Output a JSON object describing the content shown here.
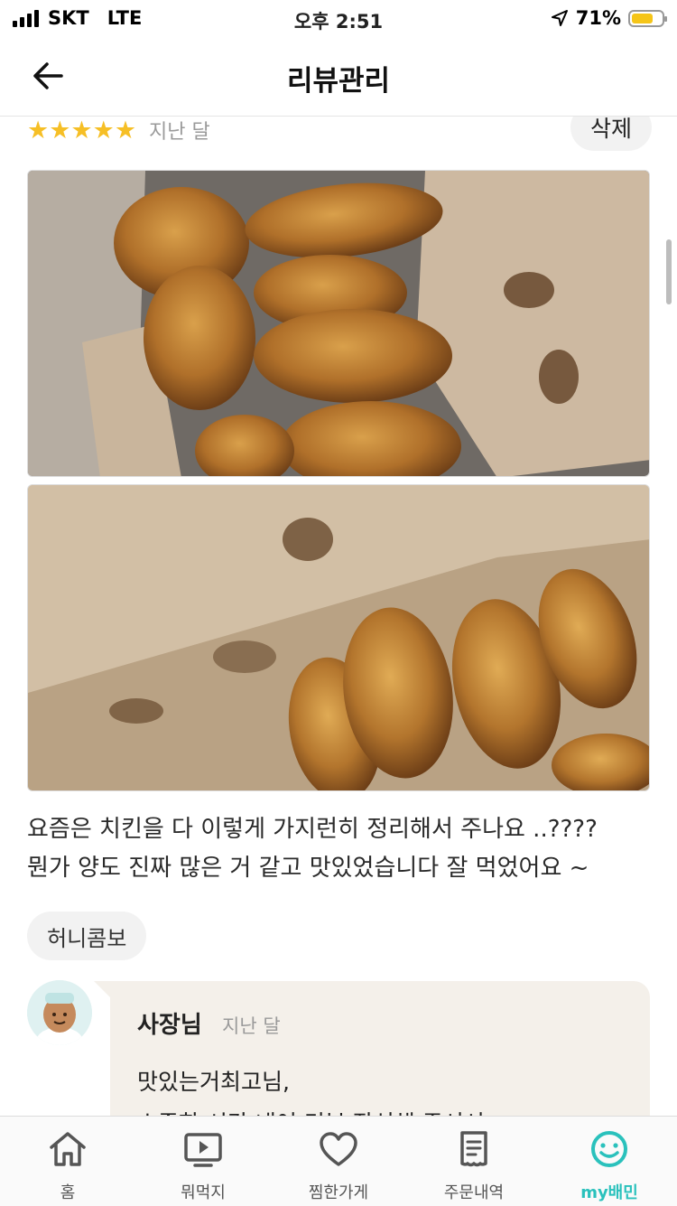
{
  "status_bar": {
    "carrier": "SKT",
    "network": "LTE",
    "time": "오후 2:51",
    "battery": "71%",
    "battery_level": 0.71
  },
  "nav": {
    "title": "리뷰관리",
    "back_icon": "arrow-left-icon"
  },
  "review": {
    "stars": "★★★★★",
    "rating": 5,
    "ago": "지난 달",
    "delete_label": "삭제",
    "text_lines": [
      "요즘은 치킨을 다 이렇게 가지런히 정리해서 주나요 ..????",
      "뭔가 양도 진짜 많은 거 같고 맛있었습니다 잘 먹었어요 ~"
    ],
    "menu_tag": "허니콤보"
  },
  "owner_reply": {
    "name": "사장님",
    "ago": "지난 달",
    "lines": [
      "맛있는거최고님,",
      "소중한 시간 내어 리뷰 작성해 주셔서"
    ]
  },
  "tabs": [
    {
      "label": "홈",
      "icon": "home-icon"
    },
    {
      "label": "뭐먹지",
      "icon": "play-screen-icon"
    },
    {
      "label": "찜한가게",
      "icon": "heart-icon"
    },
    {
      "label": "주문내역",
      "icon": "receipt-icon"
    },
    {
      "label": "my배민",
      "icon": "smile-icon"
    }
  ],
  "colors": {
    "accent": "#2ac1bc",
    "star": "#f6bf26",
    "reply_bg": "#f4f0ea"
  }
}
